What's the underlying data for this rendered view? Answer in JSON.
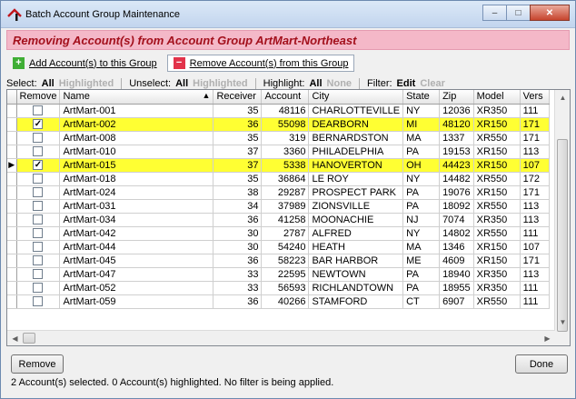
{
  "window": {
    "title": "Batch Account Group Maintenance",
    "minimize_glyph": "–",
    "maximize_glyph": "□",
    "close_glyph": "✕"
  },
  "banner": "Removing Account(s) from Account Group ArtMart-Northeast",
  "toolbar": {
    "add_label": "Add Account(s) to this Group",
    "remove_label": "Remove Account(s) from this Group"
  },
  "selection_bar": {
    "select_label": "Select:",
    "select_all": "All",
    "select_highlighted": "Highlighted",
    "unselect_label": "Unselect:",
    "unselect_all": "All",
    "unselect_highlighted": "Highlighted",
    "highlight_label": "Highlight:",
    "highlight_all": "All",
    "highlight_none": "None",
    "filter_label": "Filter:",
    "filter_edit": "Edit",
    "filter_clear": "Clear"
  },
  "grid": {
    "columns": [
      "Remove",
      "Name",
      "Receiver",
      "Account",
      "City",
      "State",
      "Zip",
      "Model",
      "Vers"
    ],
    "rows": [
      {
        "checked": false,
        "highlighted": false,
        "current": false,
        "cells": [
          "ArtMart-001",
          "35",
          "48116",
          "CHARLOTTEVILLE",
          "NY",
          "12036",
          "XR350",
          "111"
        ]
      },
      {
        "checked": true,
        "highlighted": true,
        "current": false,
        "cells": [
          "ArtMart-002",
          "36",
          "55098",
          "DEARBORN",
          "MI",
          "48120",
          "XR150",
          "171"
        ]
      },
      {
        "checked": false,
        "highlighted": false,
        "current": false,
        "cells": [
          "ArtMart-008",
          "35",
          "319",
          "BERNARDSTON",
          "MA",
          "1337",
          "XR550",
          "171"
        ]
      },
      {
        "checked": false,
        "highlighted": false,
        "current": false,
        "cells": [
          "ArtMart-010",
          "37",
          "3360",
          "PHILADELPHIA",
          "PA",
          "19153",
          "XR150",
          "113"
        ]
      },
      {
        "checked": true,
        "highlighted": true,
        "current": true,
        "cells": [
          "ArtMart-015",
          "37",
          "5338",
          "HANOVERTON",
          "OH",
          "44423",
          "XR150",
          "107"
        ]
      },
      {
        "checked": false,
        "highlighted": false,
        "current": false,
        "cells": [
          "ArtMart-018",
          "35",
          "36864",
          "LE ROY",
          "NY",
          "14482",
          "XR550",
          "172"
        ]
      },
      {
        "checked": false,
        "highlighted": false,
        "current": false,
        "cells": [
          "ArtMart-024",
          "38",
          "29287",
          "PROSPECT PARK",
          "PA",
          "19076",
          "XR150",
          "171"
        ]
      },
      {
        "checked": false,
        "highlighted": false,
        "current": false,
        "cells": [
          "ArtMart-031",
          "34",
          "37989",
          "ZIONSVILLE",
          "PA",
          "18092",
          "XR550",
          "113"
        ]
      },
      {
        "checked": false,
        "highlighted": false,
        "current": false,
        "cells": [
          "ArtMart-034",
          "36",
          "41258",
          "MOONACHIE",
          "NJ",
          "7074",
          "XR350",
          "113"
        ]
      },
      {
        "checked": false,
        "highlighted": false,
        "current": false,
        "cells": [
          "ArtMart-042",
          "30",
          "2787",
          "ALFRED",
          "NY",
          "14802",
          "XR550",
          "111"
        ]
      },
      {
        "checked": false,
        "highlighted": false,
        "current": false,
        "cells": [
          "ArtMart-044",
          "30",
          "54240",
          "HEATH",
          "MA",
          "1346",
          "XR150",
          "107"
        ]
      },
      {
        "checked": false,
        "highlighted": false,
        "current": false,
        "cells": [
          "ArtMart-045",
          "36",
          "58223",
          "BAR HARBOR",
          "ME",
          "4609",
          "XR150",
          "171"
        ]
      },
      {
        "checked": false,
        "highlighted": false,
        "current": false,
        "cells": [
          "ArtMart-047",
          "33",
          "22595",
          "NEWTOWN",
          "PA",
          "18940",
          "XR350",
          "113"
        ]
      },
      {
        "checked": false,
        "highlighted": false,
        "current": false,
        "cells": [
          "ArtMart-052",
          "33",
          "56593",
          "RICHLANDTOWN",
          "PA",
          "18955",
          "XR350",
          "111"
        ]
      },
      {
        "checked": false,
        "highlighted": false,
        "current": false,
        "cells": [
          "ArtMart-059",
          "36",
          "40266",
          "STAMFORD",
          "CT",
          "6907",
          "XR550",
          "111"
        ]
      }
    ]
  },
  "buttons": {
    "remove": "Remove",
    "done": "Done"
  },
  "status": "2 Account(s) selected.  0 Account(s) highlighted.  No filter is being applied.",
  "colors": {
    "highlight_row": "#ffff33",
    "banner_bg": "#f4b8c8",
    "banner_text": "#a3101c"
  }
}
